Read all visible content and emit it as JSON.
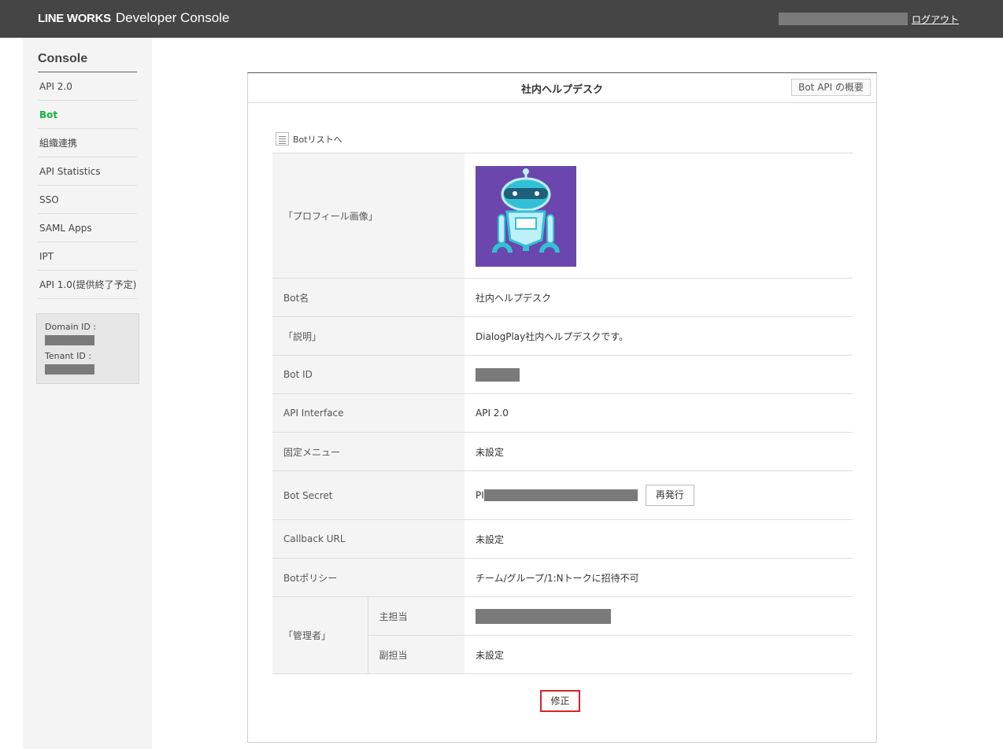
{
  "header": {
    "brand_bold": "LINE WORKS",
    "brand_light": "Developer Console",
    "logout": "ログアウト"
  },
  "sidebar": {
    "title": "Console",
    "items": [
      {
        "label": "API 2.0"
      },
      {
        "label": "Bot"
      },
      {
        "label": "組織連携"
      },
      {
        "label": "API Statistics"
      },
      {
        "label": "SSO"
      },
      {
        "label": "SAML Apps"
      },
      {
        "label": "IPT"
      },
      {
        "label": "API 1.0(提供終了予定)"
      }
    ],
    "active_item": "Bot",
    "domain_id_label": "Domain ID :",
    "tenant_id_label": "Tenant ID :"
  },
  "panel": {
    "title": "社内ヘルプデスク",
    "api_overview_button": "Bot API の概要",
    "bot_list_link": "Botリストへ",
    "rows": {
      "profile_image_label": "「プロフィール画像」",
      "bot_name_label": "Bot名",
      "bot_name_value": "社内ヘルプデスク",
      "description_label": "「説明」",
      "description_value": "DialogPlay社内ヘルプデスクです。",
      "bot_id_label": "Bot ID",
      "api_interface_label": "API Interface",
      "api_interface_value": "API 2.0",
      "fixed_menu_label": "固定メニュー",
      "fixed_menu_value": "未設定",
      "bot_secret_label": "Bot Secret",
      "bot_secret_prefix": "PI",
      "reissue_button": "再発行",
      "callback_url_label": "Callback URL",
      "callback_url_value": "未設定",
      "bot_policy_label": "Botポリシー",
      "bot_policy_value": "チーム/グループ/1:Nトークに招待不可",
      "admin_label": "「管理者」",
      "admin_main_label": "主担当",
      "admin_sub_label": "副担当",
      "admin_sub_value": "未設定"
    },
    "edit_button": "修正"
  },
  "colors": {
    "header_bg": "#454545",
    "active_nav": "#19b33b",
    "avatar_bg": "#6b47ad",
    "robot_teal": "#33c0d6",
    "edit_highlight": "#d9222a"
  }
}
